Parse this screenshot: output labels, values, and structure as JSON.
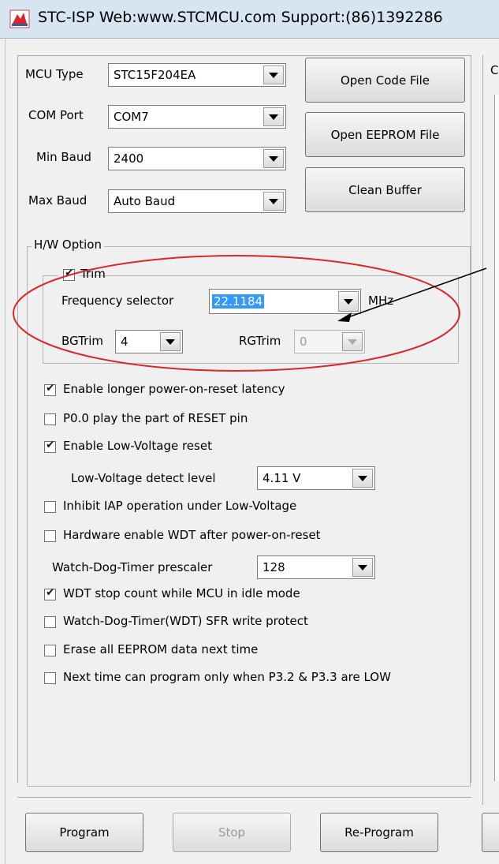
{
  "window": {
    "title": "STC-ISP  Web:www.STCMCU.com  Support:(86)1392286",
    "app_icon": "stc-app-icon"
  },
  "top_form": {
    "mcu_type": {
      "label": "MCU Type",
      "value": "STC15F204EA"
    },
    "com_port": {
      "label": "COM Port",
      "value": "COM7"
    },
    "min_baud": {
      "label": "Min Baud",
      "value": "2400"
    },
    "max_baud": {
      "label": "Max Baud",
      "value": "Auto Baud"
    }
  },
  "buttons": {
    "open_code": "Open Code File",
    "open_eeprom": "Open EEPROM File",
    "clean_buffer": "Clean Buffer",
    "program": "Program",
    "stop": "Stop",
    "reprogram": "Re-Program"
  },
  "hw_option": {
    "title": "H/W Option",
    "trim": {
      "label": "Trim",
      "checked": true,
      "frequency_label": "Frequency selector",
      "frequency_value": "22.1184",
      "frequency_unit": "MHz",
      "bgtrim_label": "BGTrim",
      "bgtrim_value": "4",
      "rgtrim_label": "RGTrim",
      "rgtrim_value": "0"
    },
    "options": [
      {
        "label": "Enable longer power-on-reset latency",
        "checked": true
      },
      {
        "label": "P0.0 play the part of RESET pin",
        "checked": false
      },
      {
        "label": "Enable Low-Voltage reset",
        "checked": true
      },
      {
        "label": "Inhibit IAP operation under Low-Voltage",
        "checked": false
      },
      {
        "label": "Hardware enable WDT after power-on-reset",
        "checked": false
      },
      {
        "label": "WDT stop count while MCU in idle mode",
        "checked": true
      },
      {
        "label": "Watch-Dog-Timer(WDT) SFR write protect",
        "checked": false
      },
      {
        "label": "Erase all EEPROM data next time",
        "checked": false
      },
      {
        "label": "Next time can program only when P3.2 & P3.3 are LOW",
        "checked": false
      }
    ],
    "low_voltage_level": {
      "label": "Low-Voltage detect level",
      "value": "4.11 V"
    },
    "wdt_prescaler": {
      "label": "Watch-Dog-Timer prescaler",
      "value": "128"
    }
  },
  "right_panel": {
    "partial_label": "C"
  },
  "annotation": {
    "ellipse_color": "#d9262b",
    "arrow_color": "#000000"
  }
}
